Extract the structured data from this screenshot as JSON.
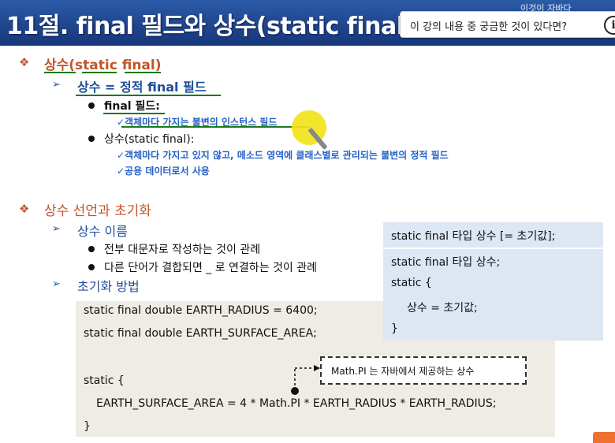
{
  "title": "11절. final 필드와 상수(static final",
  "title_right": "이것이 자바다",
  "question_prompt": "이 강의 내용 중 궁금한 것이 있다면?",
  "info_glyph": "i",
  "section1": {
    "heading": "상수(static final)",
    "sub": "상수 = 정적 final 필드",
    "items": [
      {
        "label": "final 필드:",
        "notes": [
          "✓객체마다 가지는 불변의 인스턴스 필드"
        ]
      },
      {
        "label": "상수(static final):",
        "notes": [
          "✓객체마다 가지고 있지 않고, 메소드 영역에 클래스별로 관리되는 불변의 정적 필드",
          "✓공용 데이터로서 사용"
        ]
      }
    ]
  },
  "section2": {
    "heading": "상수 선언과 초기화",
    "naming": {
      "sub": "상수 이름",
      "bullets": [
        "전부 대문자로 작성하는 것이 관례",
        "다른 단어가 결합되면 _ 로 연결하는 것이 관례"
      ]
    },
    "init_sub": "초기화 방법"
  },
  "syntax_box": {
    "line1": "static final 타입 상수 [= 초기값];",
    "line2": "static final 타입 상수;",
    "line3": "static {",
    "line4": "상수 = 초기값;",
    "line5": "}"
  },
  "code": {
    "line1": "static final double EARTH_RADIUS = 6400;",
    "line2": "static final double EARTH_SURFACE_AREA;",
    "line3": "static {",
    "line4": "EARTH_SURFACE_AREA = 4 * Math.PI * EARTH_RADIUS * EARTH_RADIUS;",
    "line5": "}"
  },
  "callout": "Math.PI 는 자바에서 제공하는 상수",
  "colors": {
    "title_bg": "#1f4591",
    "heading": "#c2542a",
    "subheading": "#1f4e9a",
    "note": "#2461c8"
  },
  "icons": {
    "diamond": "❖",
    "arrow": "➢"
  }
}
